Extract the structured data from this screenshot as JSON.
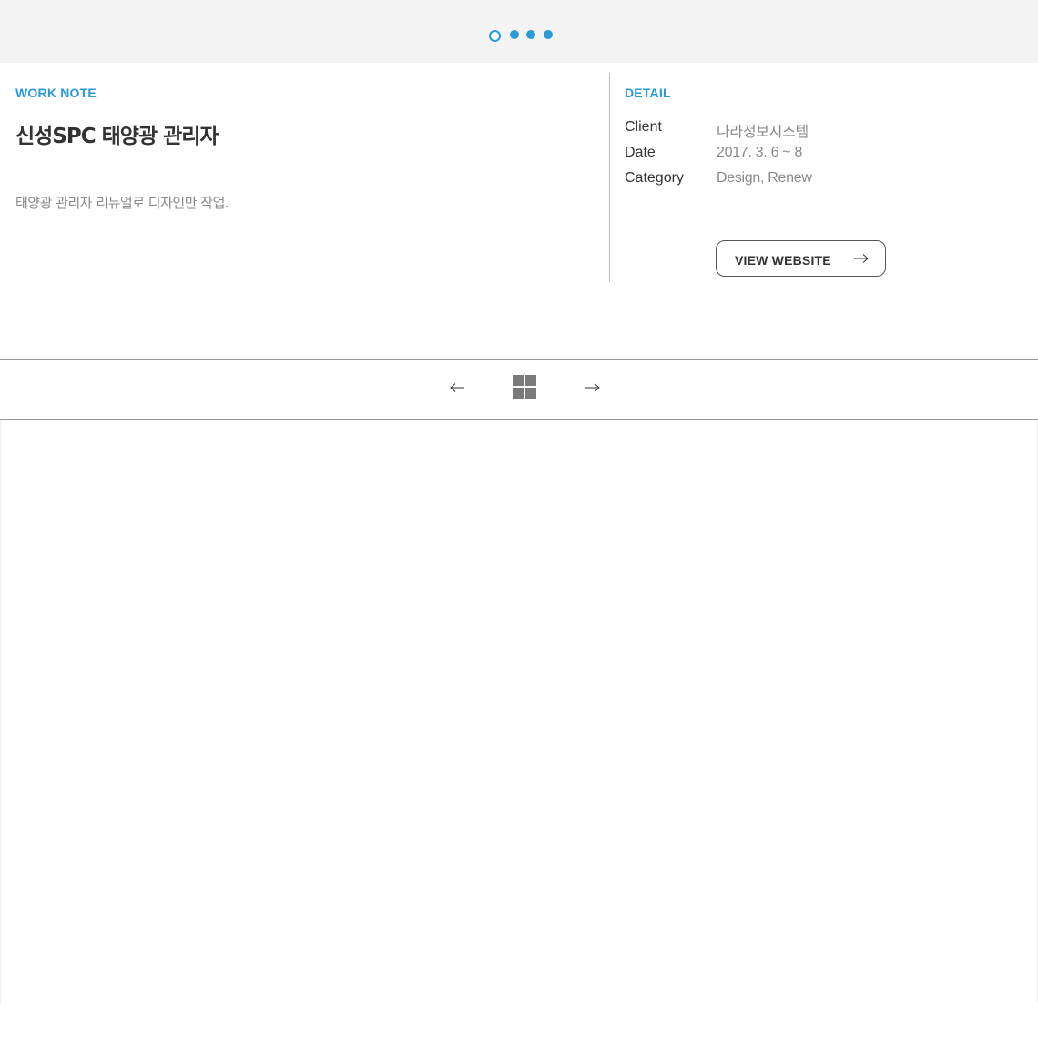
{
  "slider": {
    "dots": [
      {
        "label": "slide-1",
        "active": true
      },
      {
        "label": "slide-2",
        "active": false
      },
      {
        "label": "slide-3",
        "active": false
      },
      {
        "label": "slide-4",
        "active": false
      }
    ],
    "accent_color": "#2a9ad8"
  },
  "work_note": {
    "label": "WORK NOTE",
    "title": "신성SPC 태양광 관리자",
    "description": "태양광 관리자 리뉴얼로 디자인만 작업."
  },
  "detail": {
    "label": "DETAIL",
    "rows": [
      {
        "key": "Client",
        "value": "나라정보시스템"
      },
      {
        "key": "Date",
        "value": "2017. 3. 6 ~ 8"
      },
      {
        "key": "Category",
        "value": "Design, Renew"
      }
    ],
    "view_button_label": "VIEW WEBSITE",
    "view_button_icon": "arrow-right-icon"
  },
  "nav": {
    "prev_icon": "arrow-left-icon",
    "grid_icon": "grid-icon",
    "next_icon": "arrow-right-icon"
  }
}
